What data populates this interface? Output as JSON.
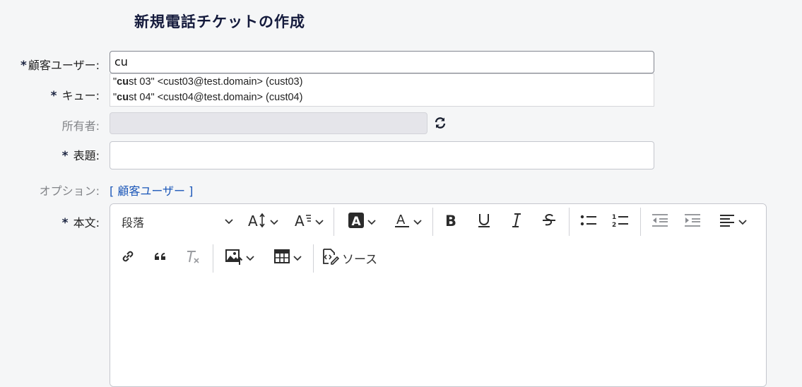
{
  "page": {
    "title": "新規電話チケットの作成"
  },
  "form": {
    "customer": {
      "required_mark": "*",
      "label": "顧客ユーザー:",
      "value": "cu"
    },
    "autocomplete": [
      {
        "bold": "cu",
        "rest": "st 03\" <cust03@test.domain> (cust03)",
        "prefix": "\""
      },
      {
        "bold": "cu",
        "rest": "st 04\" <cust04@test.domain> (cust04)",
        "prefix": "\""
      }
    ],
    "queue": {
      "required_mark": "*",
      "label": "キュー:"
    },
    "owner": {
      "label": "所有者:"
    },
    "subject": {
      "required_mark": "*",
      "label": "表題:",
      "value": ""
    },
    "options": {
      "label": "オプション:",
      "link": "[ 顧客ユーザー ]"
    },
    "body": {
      "required_mark": "*",
      "label": "本文:"
    }
  },
  "editor": {
    "paragraph_select": "段落",
    "source_label": "ソース",
    "icons": [
      "font-size-icon",
      "font-format-icon",
      "highlight-color-icon",
      "font-color-icon",
      "bold-icon",
      "underline-icon",
      "italic-icon",
      "strikethrough-icon",
      "bulleted-list-icon",
      "numbered-list-icon",
      "outdent-icon",
      "indent-icon",
      "align-icon",
      "link-icon",
      "blockquote-icon",
      "remove-format-icon",
      "insert-image-icon",
      "insert-table-icon",
      "source-icon"
    ]
  }
}
